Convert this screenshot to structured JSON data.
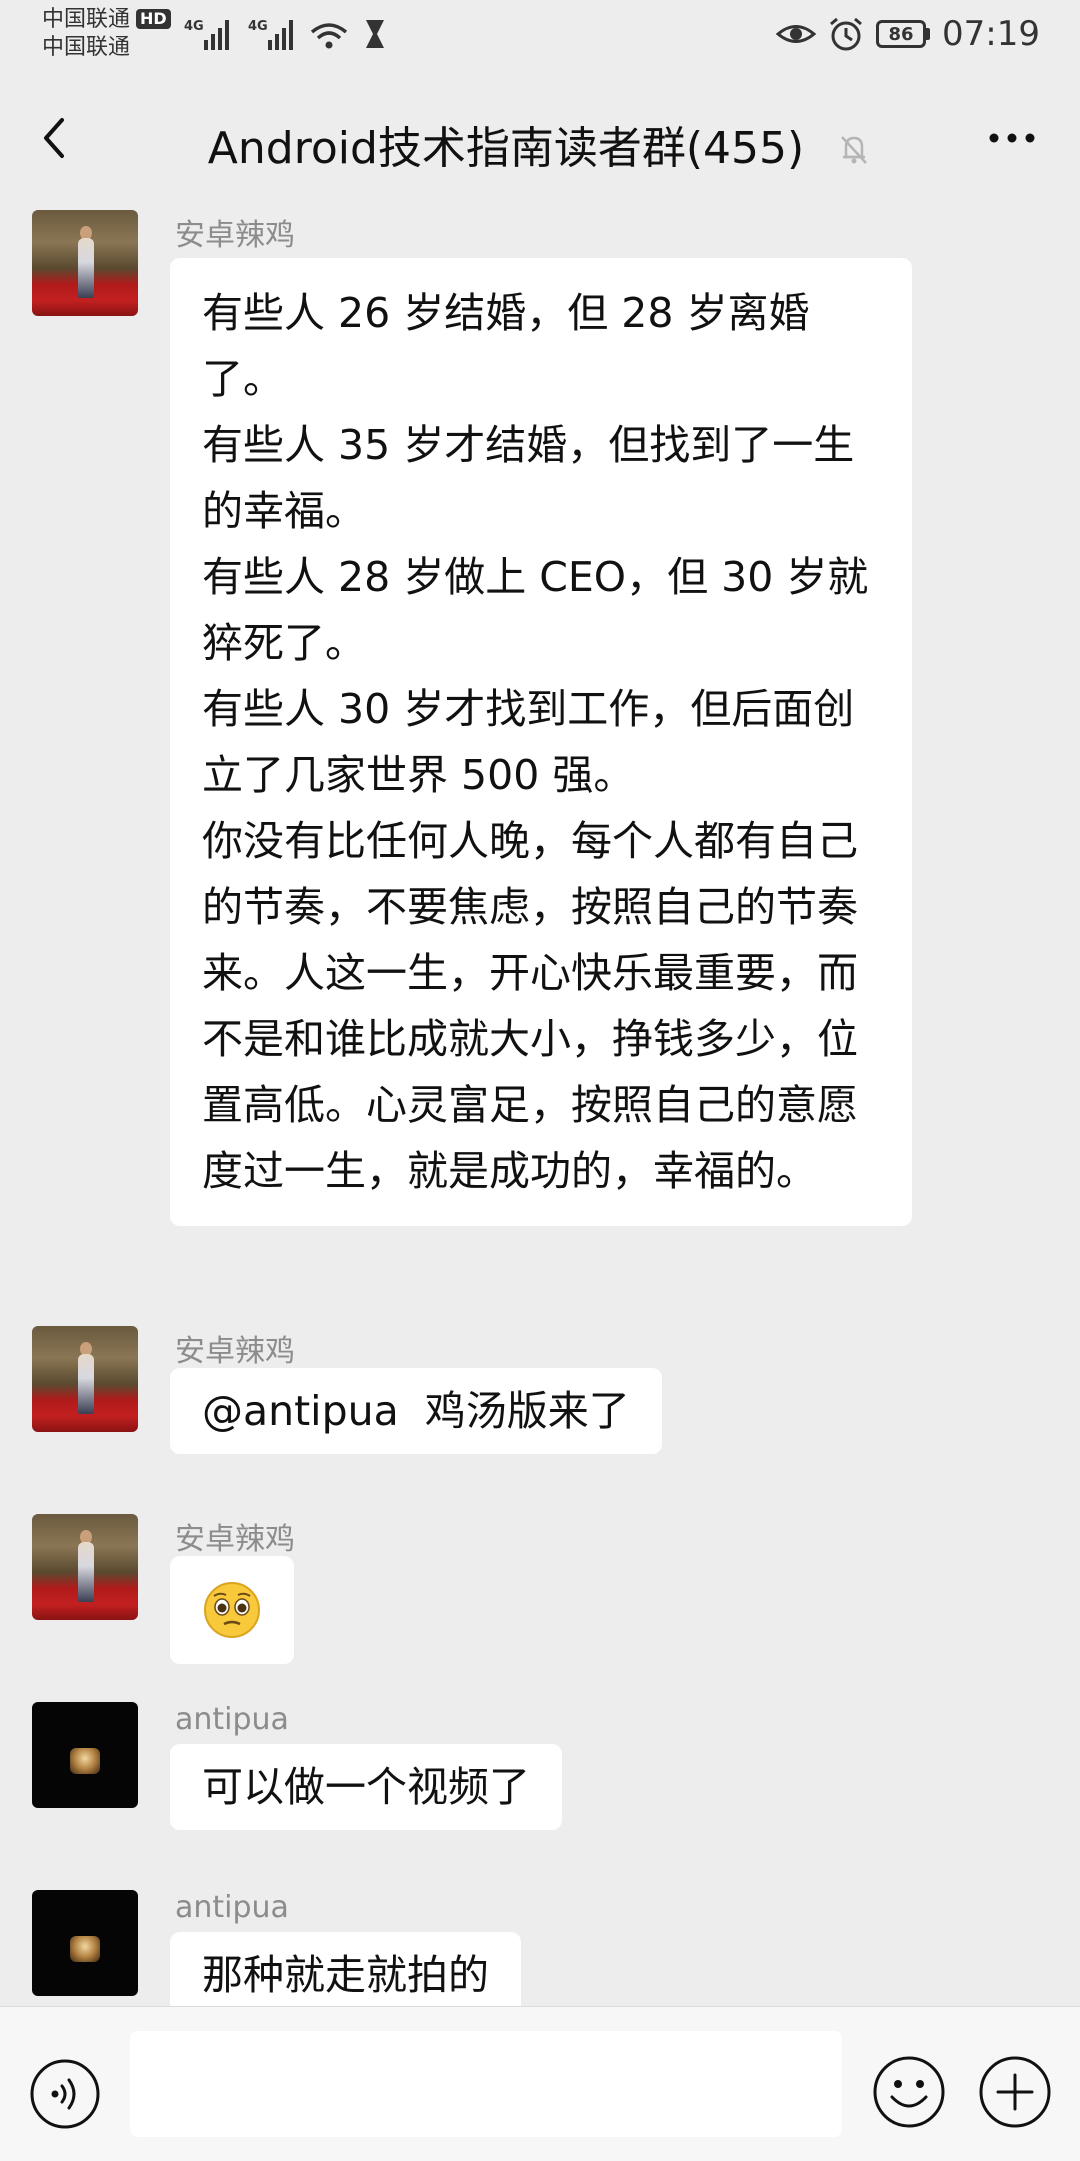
{
  "status_bar": {
    "carrier_1": "中国联通",
    "carrier_2": "中国联通",
    "hd_badge": "HD",
    "net_1": "4G",
    "net_2": "4G",
    "battery": "86",
    "time": "07:19"
  },
  "header": {
    "title": "Android技术指南读者群(455)"
  },
  "messages": [
    {
      "sender": "安卓辣鸡",
      "lines": [
        "有些人 26 岁结婚，但 28 岁离婚了。",
        "有些人 35 岁才结婚，但找到了一生的幸福。",
        "有些人 28 岁做上 CEO，但 30 岁就猝死了。",
        "有些人 30 岁才找到工作，但后面创立了几家世界 500 强。",
        "你没有比任何人晚，每个人都有自己的节奏，不要焦虑，按照自己的节奏来。人这一生，开心快乐最重要，而不是和谁比成就大小，挣钱多少，位置高低。心灵富足，按照自己的意愿度过一生，就是成功的，幸福的。"
      ]
    },
    {
      "sender": "安卓辣鸡",
      "text": "@antipua  鸡汤版来了"
    },
    {
      "sender": "安卓辣鸡",
      "emoji": "🥺"
    },
    {
      "sender": "antipua",
      "text": "可以做一个视频了"
    },
    {
      "sender": "antipua",
      "text": "那种就走就拍的"
    }
  ],
  "input": {
    "value": "",
    "placeholder": ""
  },
  "icons": {
    "back": "back-arrow-icon",
    "mute": "bell-off-icon",
    "more": "more-dots-icon",
    "voice": "voice-icon",
    "emoji": "emoji-icon",
    "plus": "plus-icon"
  }
}
